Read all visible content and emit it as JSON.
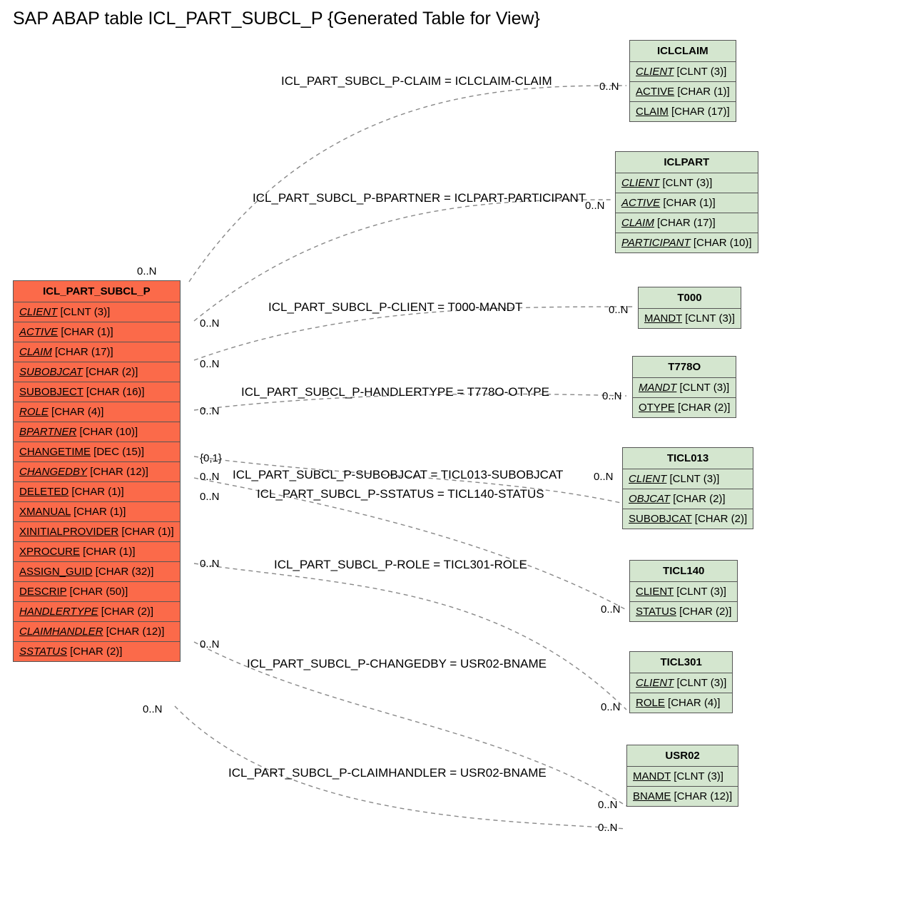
{
  "title": "SAP ABAP table ICL_PART_SUBCL_P {Generated Table for View}",
  "main": {
    "name": "ICL_PART_SUBCL_P",
    "fields": [
      {
        "n": "CLIENT",
        "t": "CLNT (3)",
        "i": true
      },
      {
        "n": "ACTIVE",
        "t": "CHAR (1)",
        "i": true
      },
      {
        "n": "CLAIM",
        "t": "CHAR (17)",
        "i": true
      },
      {
        "n": "SUBOBJCAT",
        "t": "CHAR (2)",
        "i": true
      },
      {
        "n": "SUBOBJECT",
        "t": "CHAR (16)",
        "i": false
      },
      {
        "n": "ROLE",
        "t": "CHAR (4)",
        "i": true
      },
      {
        "n": "BPARTNER",
        "t": "CHAR (10)",
        "i": true
      },
      {
        "n": "CHANGETIME",
        "t": "DEC (15)",
        "i": false
      },
      {
        "n": "CHANGEDBY",
        "t": "CHAR (12)",
        "i": true
      },
      {
        "n": "DELETED",
        "t": "CHAR (1)",
        "i": false
      },
      {
        "n": "XMANUAL",
        "t": "CHAR (1)",
        "i": false
      },
      {
        "n": "XINITIALPROVIDER",
        "t": "CHAR (1)",
        "i": false
      },
      {
        "n": "XPROCURE",
        "t": "CHAR (1)",
        "i": false
      },
      {
        "n": "ASSIGN_GUID",
        "t": "CHAR (32)",
        "i": false
      },
      {
        "n": "DESCRIP",
        "t": "CHAR (50)",
        "i": false
      },
      {
        "n": "HANDLERTYPE",
        "t": "CHAR (2)",
        "i": true
      },
      {
        "n": "CLAIMHANDLER",
        "t": "CHAR (12)",
        "i": true
      },
      {
        "n": "SSTATUS",
        "t": "CHAR (2)",
        "i": true
      }
    ]
  },
  "rels": [
    {
      "label": "ICL_PART_SUBCL_P-CLAIM = ICLCLAIM-CLAIM"
    },
    {
      "label": "ICL_PART_SUBCL_P-BPARTNER = ICLPART-PARTICIPANT"
    },
    {
      "label": "ICL_PART_SUBCL_P-CLIENT = T000-MANDT"
    },
    {
      "label": "ICL_PART_SUBCL_P-HANDLERTYPE = T778O-OTYPE"
    },
    {
      "label": "ICL_PART_SUBCL_P-SUBOBJCAT = TICL013-SUBOBJCAT"
    },
    {
      "label": "ICL_PART_SUBCL_P-SSTATUS = TICL140-STATUS"
    },
    {
      "label": "ICL_PART_SUBCL_P-ROLE = TICL301-ROLE"
    },
    {
      "label": "ICL_PART_SUBCL_P-CHANGEDBY = USR02-BNAME"
    },
    {
      "label": "ICL_PART_SUBCL_P-CLAIMHANDLER = USR02-BNAME"
    }
  ],
  "cards": {
    "leftTop": "0..N",
    "r0": "0..N",
    "r1": "0..N",
    "r2": "0..N",
    "r3": "0..N",
    "r4": "{0,1}",
    "r5": "0..N",
    "r6": "0..N",
    "r7": "0..N",
    "r8": "0..N",
    "t0": "0..N",
    "t1": "0..N",
    "t2": "0..N",
    "t3": "0..N",
    "t4": "0..N",
    "t5": "0..N",
    "t6": "0..N",
    "t7": "0..N",
    "t8": "0..N",
    "leftBot": "0..N"
  },
  "right": [
    {
      "name": "ICLCLAIM",
      "fields": [
        {
          "n": "CLIENT",
          "t": "CLNT (3)",
          "i": true
        },
        {
          "n": "ACTIVE",
          "t": "CHAR (1)",
          "i": false
        },
        {
          "n": "CLAIM",
          "t": "CHAR (17)",
          "i": false
        }
      ]
    },
    {
      "name": "ICLPART",
      "fields": [
        {
          "n": "CLIENT",
          "t": "CLNT (3)",
          "i": true
        },
        {
          "n": "ACTIVE",
          "t": "CHAR (1)",
          "i": true
        },
        {
          "n": "CLAIM",
          "t": "CHAR (17)",
          "i": true
        },
        {
          "n": "PARTICIPANT",
          "t": "CHAR (10)",
          "i": true
        }
      ]
    },
    {
      "name": "T000",
      "fields": [
        {
          "n": "MANDT",
          "t": "CLNT (3)",
          "i": false
        }
      ]
    },
    {
      "name": "T778O",
      "fields": [
        {
          "n": "MANDT",
          "t": "CLNT (3)",
          "i": true
        },
        {
          "n": "OTYPE",
          "t": "CHAR (2)",
          "i": false
        }
      ]
    },
    {
      "name": "TICL013",
      "fields": [
        {
          "n": "CLIENT",
          "t": "CLNT (3)",
          "i": true
        },
        {
          "n": "OBJCAT",
          "t": "CHAR (2)",
          "i": true
        },
        {
          "n": "SUBOBJCAT",
          "t": "CHAR (2)",
          "i": false
        }
      ]
    },
    {
      "name": "TICL140",
      "fields": [
        {
          "n": "CLIENT",
          "t": "CLNT (3)",
          "i": false
        },
        {
          "n": "STATUS",
          "t": "CHAR (2)",
          "i": false
        }
      ]
    },
    {
      "name": "TICL301",
      "fields": [
        {
          "n": "CLIENT",
          "t": "CLNT (3)",
          "i": true
        },
        {
          "n": "ROLE",
          "t": "CHAR (4)",
          "i": false
        }
      ]
    },
    {
      "name": "USR02",
      "fields": [
        {
          "n": "MANDT",
          "t": "CLNT (3)",
          "i": false
        },
        {
          "n": "BNAME",
          "t": "CHAR (12)",
          "i": false
        }
      ]
    }
  ]
}
